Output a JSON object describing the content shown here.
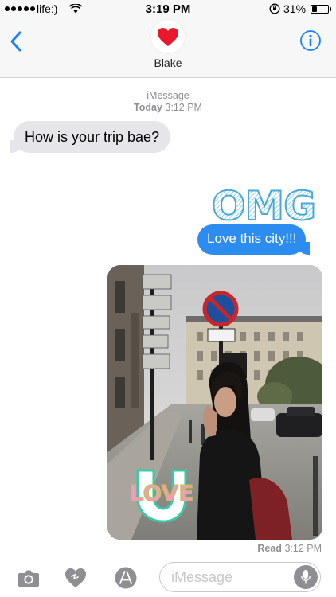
{
  "status_bar": {
    "carrier": "life:)",
    "time": "3:19 PM",
    "battery": "31%",
    "battery_level": 0.31
  },
  "header": {
    "contact_name": "Blake",
    "avatar_icon": "heart-icon",
    "back_icon": "chevron-left-icon",
    "info_icon": "info-icon"
  },
  "conversation": {
    "service": "iMessage",
    "date_day": "Today",
    "date_time": "3:12 PM",
    "messages": [
      {
        "direction": "incoming",
        "text": "How is your trip bae?"
      },
      {
        "direction": "outgoing",
        "sticker_text": "OMG",
        "text": "Love this city!!!"
      },
      {
        "direction": "outgoing",
        "type": "photo",
        "sticker_text": "LOVE"
      }
    ],
    "read_label": "Read",
    "read_time": "3:12 PM"
  },
  "input_bar": {
    "placeholder": "iMessage",
    "tools": [
      "camera-icon",
      "digital-touch-icon",
      "app-store-icon"
    ]
  },
  "colors": {
    "accent": "#2d8cf0",
    "incoming_bubble": "#e5e5ea",
    "heart": "#e8192c",
    "secondary_text": "#8e8e93"
  }
}
